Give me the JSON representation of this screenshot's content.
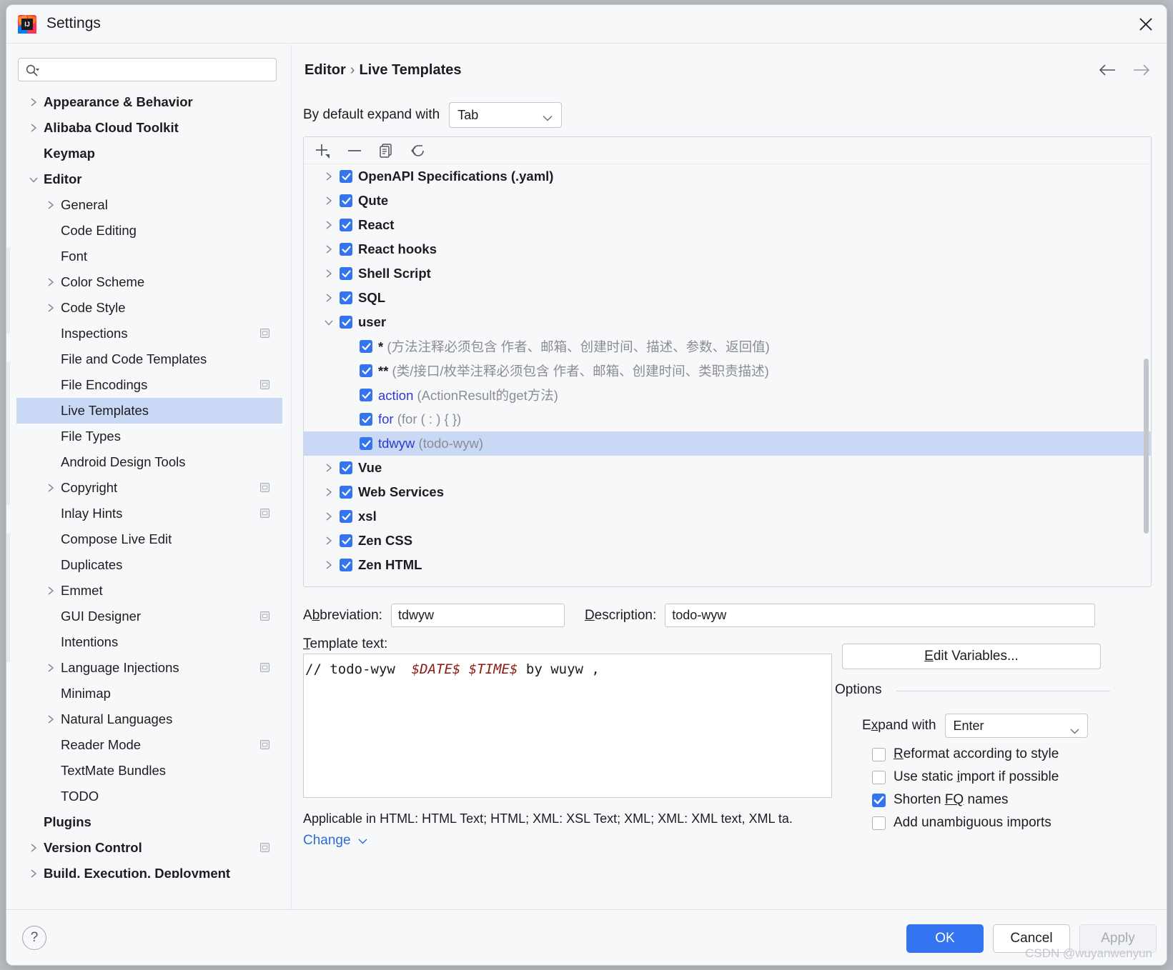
{
  "window": {
    "title": "Settings",
    "app_icon": "intellij-idea-logo",
    "close_icon": "close-icon"
  },
  "search": {
    "placeholder": "",
    "value": "",
    "icon": "search-icon"
  },
  "sidebar": {
    "items": [
      {
        "label": "Appearance & Behavior",
        "indent": 0,
        "twisty": "collapsed",
        "bold": true,
        "badge": false,
        "selected": false
      },
      {
        "label": "Alibaba Cloud Toolkit",
        "indent": 0,
        "twisty": "collapsed",
        "bold": true,
        "badge": false,
        "selected": false
      },
      {
        "label": "Keymap",
        "indent": 0,
        "twisty": "none",
        "bold": true,
        "badge": false,
        "selected": false
      },
      {
        "label": "Editor",
        "indent": 0,
        "twisty": "expanded",
        "bold": true,
        "badge": false,
        "selected": false
      },
      {
        "label": "General",
        "indent": 1,
        "twisty": "collapsed",
        "bold": false,
        "badge": false,
        "selected": false
      },
      {
        "label": "Code Editing",
        "indent": 1,
        "twisty": "none",
        "bold": false,
        "badge": false,
        "selected": false
      },
      {
        "label": "Font",
        "indent": 1,
        "twisty": "none",
        "bold": false,
        "badge": false,
        "selected": false
      },
      {
        "label": "Color Scheme",
        "indent": 1,
        "twisty": "collapsed",
        "bold": false,
        "badge": false,
        "selected": false
      },
      {
        "label": "Code Style",
        "indent": 1,
        "twisty": "collapsed",
        "bold": false,
        "badge": false,
        "selected": false
      },
      {
        "label": "Inspections",
        "indent": 1,
        "twisty": "none",
        "bold": false,
        "badge": true,
        "selected": false
      },
      {
        "label": "File and Code Templates",
        "indent": 1,
        "twisty": "none",
        "bold": false,
        "badge": false,
        "selected": false
      },
      {
        "label": "File Encodings",
        "indent": 1,
        "twisty": "none",
        "bold": false,
        "badge": true,
        "selected": false
      },
      {
        "label": "Live Templates",
        "indent": 1,
        "twisty": "none",
        "bold": false,
        "badge": false,
        "selected": true
      },
      {
        "label": "File Types",
        "indent": 1,
        "twisty": "none",
        "bold": false,
        "badge": false,
        "selected": false
      },
      {
        "label": "Android Design Tools",
        "indent": 1,
        "twisty": "none",
        "bold": false,
        "badge": false,
        "selected": false
      },
      {
        "label": "Copyright",
        "indent": 1,
        "twisty": "collapsed",
        "bold": false,
        "badge": true,
        "selected": false
      },
      {
        "label": "Inlay Hints",
        "indent": 1,
        "twisty": "none",
        "bold": false,
        "badge": true,
        "selected": false
      },
      {
        "label": "Compose Live Edit",
        "indent": 1,
        "twisty": "none",
        "bold": false,
        "badge": false,
        "selected": false
      },
      {
        "label": "Duplicates",
        "indent": 1,
        "twisty": "none",
        "bold": false,
        "badge": false,
        "selected": false
      },
      {
        "label": "Emmet",
        "indent": 1,
        "twisty": "collapsed",
        "bold": false,
        "badge": false,
        "selected": false
      },
      {
        "label": "GUI Designer",
        "indent": 1,
        "twisty": "none",
        "bold": false,
        "badge": true,
        "selected": false
      },
      {
        "label": "Intentions",
        "indent": 1,
        "twisty": "none",
        "bold": false,
        "badge": false,
        "selected": false
      },
      {
        "label": "Language Injections",
        "indent": 1,
        "twisty": "collapsed",
        "bold": false,
        "badge": true,
        "selected": false
      },
      {
        "label": "Minimap",
        "indent": 1,
        "twisty": "none",
        "bold": false,
        "badge": false,
        "selected": false
      },
      {
        "label": "Natural Languages",
        "indent": 1,
        "twisty": "collapsed",
        "bold": false,
        "badge": false,
        "selected": false
      },
      {
        "label": "Reader Mode",
        "indent": 1,
        "twisty": "none",
        "bold": false,
        "badge": true,
        "selected": false
      },
      {
        "label": "TextMate Bundles",
        "indent": 1,
        "twisty": "none",
        "bold": false,
        "badge": false,
        "selected": false
      },
      {
        "label": "TODO",
        "indent": 1,
        "twisty": "none",
        "bold": false,
        "badge": false,
        "selected": false
      },
      {
        "label": "Plugins",
        "indent": 0,
        "twisty": "none",
        "bold": true,
        "badge": false,
        "selected": false
      },
      {
        "label": "Version Control",
        "indent": 0,
        "twisty": "collapsed",
        "bold": true,
        "badge": true,
        "selected": false
      },
      {
        "label": "Build, Execution, Deployment",
        "indent": 0,
        "twisty": "collapsed",
        "bold": true,
        "badge": false,
        "selected": false
      }
    ]
  },
  "breadcrumb": {
    "parent": "Editor",
    "separator": "›",
    "current": "Live Templates"
  },
  "nav": {
    "back_icon": "arrow-left-icon",
    "forward_icon": "arrow-right-icon"
  },
  "expand_default": {
    "label": "By default expand with",
    "value": "Tab"
  },
  "toolbar": {
    "add": "add-icon",
    "remove": "remove-icon",
    "duplicate": "duplicate-icon",
    "revert": "revert-icon"
  },
  "template_list": [
    {
      "type": "group",
      "label": "OpenAPI Specifications (.yaml)",
      "checked": true,
      "twisty": "collapsed",
      "selected": false
    },
    {
      "type": "group",
      "label": "Qute",
      "checked": true,
      "twisty": "collapsed",
      "selected": false
    },
    {
      "type": "group",
      "label": "React",
      "checked": true,
      "twisty": "collapsed",
      "selected": false
    },
    {
      "type": "group",
      "label": "React hooks",
      "checked": true,
      "twisty": "collapsed",
      "selected": false
    },
    {
      "type": "group",
      "label": "Shell Script",
      "checked": true,
      "twisty": "collapsed",
      "selected": false
    },
    {
      "type": "group",
      "label": "SQL",
      "checked": true,
      "twisty": "collapsed",
      "selected": false
    },
    {
      "type": "group",
      "label": "user",
      "checked": true,
      "twisty": "expanded",
      "selected": false
    },
    {
      "type": "template",
      "name": "*",
      "name_plain": true,
      "desc": "(方法注释必须包含 作者、邮箱、创建时间、描述、参数、返回值)",
      "checked": true,
      "selected": false
    },
    {
      "type": "template",
      "name": "**",
      "name_plain": true,
      "desc": "(类/接口/枚举注释必须包含 作者、邮箱、创建时间、类职责描述)",
      "checked": true,
      "selected": false
    },
    {
      "type": "template",
      "name": "action",
      "name_plain": false,
      "desc": "(ActionResult的get方法)",
      "checked": true,
      "selected": false
    },
    {
      "type": "template",
      "name": "for",
      "name_plain": false,
      "desc": "(for (  : ) {            })",
      "checked": true,
      "selected": false
    },
    {
      "type": "template",
      "name": "tdwyw",
      "name_plain": false,
      "desc": "(todo-wyw)",
      "checked": true,
      "selected": true
    },
    {
      "type": "group",
      "label": "Vue",
      "checked": true,
      "twisty": "collapsed",
      "selected": false
    },
    {
      "type": "group",
      "label": "Web Services",
      "checked": true,
      "twisty": "collapsed",
      "selected": false
    },
    {
      "type": "group",
      "label": "xsl",
      "checked": true,
      "twisty": "collapsed",
      "selected": false
    },
    {
      "type": "group",
      "label": "Zen CSS",
      "checked": true,
      "twisty": "collapsed",
      "selected": false
    },
    {
      "type": "group",
      "label": "Zen HTML",
      "checked": true,
      "twisty": "collapsed",
      "selected": false
    }
  ],
  "detail": {
    "abbreviation_label_pre": "A",
    "abbreviation_label_key": "b",
    "abbreviation_label_post": "breviation:",
    "abbreviation_value": "tdwyw",
    "description_label_key": "D",
    "description_label_post": "escription:",
    "description_value": "todo-wyw",
    "template_text_label_key": "T",
    "template_text_label_post": "emplate text:",
    "code_prefix": "// todo-wyw  ",
    "code_vars": "$DATE$ $TIME$",
    "code_suffix": " by wuyw ,",
    "applicable": "Applicable in HTML: HTML Text; HTML; XML: XSL Text; XML; XML: XML text, XML ta.",
    "change_label": "Change",
    "change_chevron": "chevron-down-icon"
  },
  "options": {
    "edit_variables_key": "E",
    "edit_variables_post": "dit Variables...",
    "legend": "Options",
    "expand_with_label_pre": "E",
    "expand_with_label_key": "x",
    "expand_with_label_post": "pand with",
    "expand_with_value": "Enter",
    "checkboxes": [
      {
        "label_pre": "",
        "key": "R",
        "label_post": "eformat according to style",
        "checked": false
      },
      {
        "label_pre": "Use static ",
        "key": "i",
        "label_post": "mport if possible",
        "checked": false
      },
      {
        "label_pre": "Shorten ",
        "key": "FQ",
        "label_post": " names",
        "checked": true
      },
      {
        "label_pre": "Add unambiguous imports",
        "key": "",
        "label_post": "",
        "checked": false
      }
    ]
  },
  "footer": {
    "help_icon": "help-icon",
    "ok": "OK",
    "cancel": "Cancel",
    "apply": "Apply",
    "watermark": "CSDN @wuyanwenyun"
  },
  "colors": {
    "accent": "#3574f0",
    "selection": "#c9d8f5",
    "panel": "#f7f8fa",
    "template_name": "#2d3ad1",
    "code_var": "#8c1a11",
    "link": "#2b6cd4"
  }
}
